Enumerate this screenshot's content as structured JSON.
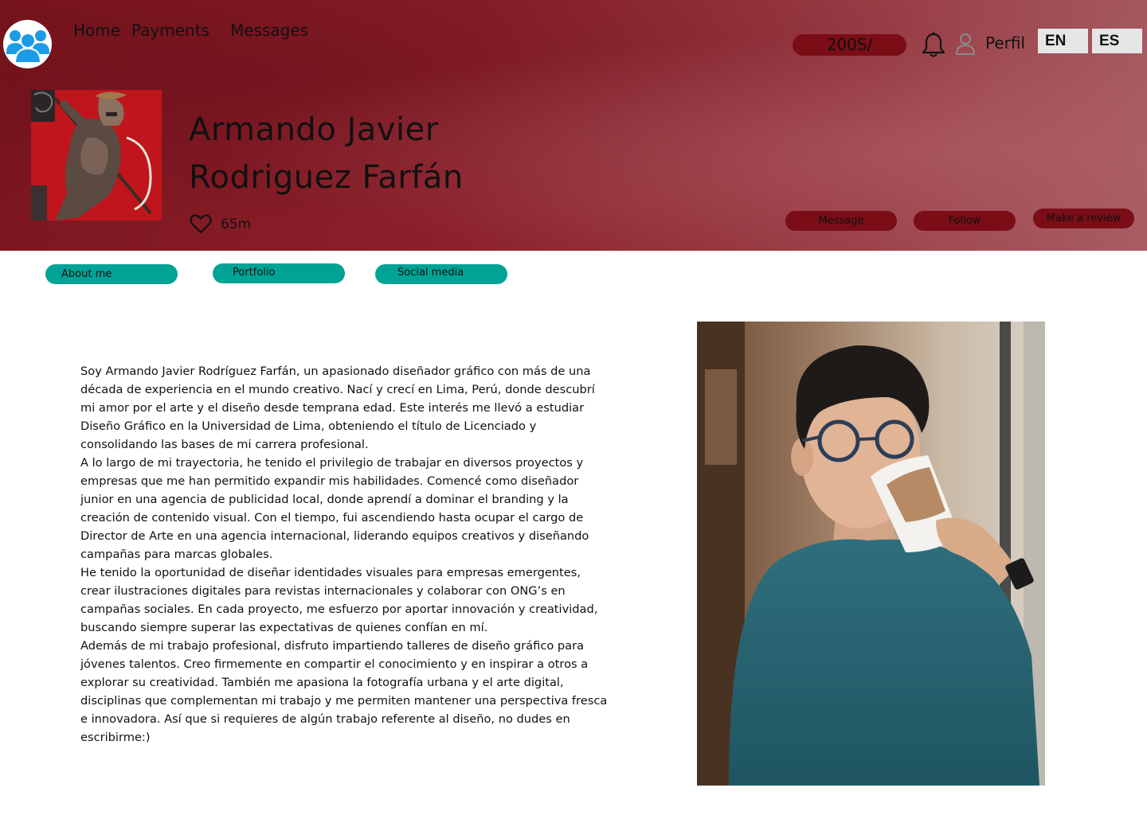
{
  "nav": {
    "home": "Home",
    "payments": "Payments",
    "messages": "Messages"
  },
  "header": {
    "balance": "200S/",
    "profile_label": "Perfil",
    "lang_en": "EN",
    "lang_es": "ES",
    "icons": [
      "people-group-icon",
      "bell-icon",
      "user-icon",
      "heart-icon"
    ]
  },
  "profile": {
    "name_line1": "Armando Javier",
    "name_line2": "Rodriguez Farfán",
    "likes": "65m",
    "actions": {
      "message": "Message",
      "follow": "Follow",
      "review": "Make a review"
    }
  },
  "tabs": {
    "about": "About me",
    "portfolio": "Portfolio",
    "social": "Social media"
  },
  "bio": {
    "p1": "Soy Armando Javier Rodríguez Farfán, un apasionado diseñador gráfico con más de una década de experiencia en el mundo creativo. Nací y crecí en Lima, Perú, donde descubrí mi amor por el arte y el diseño desde temprana edad. Este interés me llevó a estudiar Diseño Gráfico en la Universidad de Lima, obteniendo el título de Licenciado y consolidando las bases de mi carrera profesional.",
    "p2": "A lo largo de mi trayectoria, he tenido el privilegio de trabajar en diversos proyectos y empresas que me han permitido expandir mis habilidades. Comencé como diseñador junior en una agencia de publicidad local, donde aprendí a dominar el branding y la creación de contenido visual. Con el tiempo, fui ascendiendo hasta ocupar el cargo de Director de Arte en una agencia internacional, liderando equipos creativos y diseñando campañas para marcas globales.",
    "p3": "He tenido la oportunidad de diseñar identidades visuales para empresas emergentes, crear ilustraciones digitales para revistas internacionales y colaborar con ONG’s en campañas sociales. En cada proyecto, me esfuerzo por aportar innovación y creatividad, buscando siempre superar las expectativas de quienes confían en mí.",
    "p4": "Además de mi trabajo profesional, disfruto impartiendo talleres de diseño gráfico para jóvenes talentos. Creo firmemente en compartir el conocimiento y en inspirar a otros a explorar su creatividad. También me apasiona la fotografía urbana y el arte digital, disciplinas que complementan mi trabajo y me permiten mantener una perspectiva fresca e innovadora. Así que si requieres de algún trabajo referente al diseño, no dudes en escribirme:)"
  },
  "colors": {
    "banner": "#8e1f27",
    "pill_dark": "#7a0d15",
    "tab_teal": "#00a395",
    "logo_blue": "#1e9be6"
  }
}
